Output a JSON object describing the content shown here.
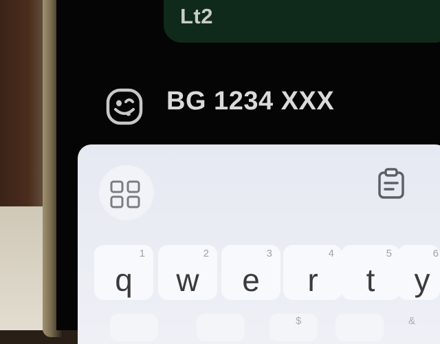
{
  "chat": {
    "last_sent_message_fragment": "Lt2"
  },
  "input": {
    "value": "BG 1234 XXX"
  },
  "icons": {
    "emoji": "emoji-icon",
    "keyboard_grid": "grid-icon",
    "clipboard": "clipboard-icon"
  },
  "keyboard": {
    "row1": [
      {
        "letter": "q",
        "number": "1"
      },
      {
        "letter": "w",
        "number": "2"
      },
      {
        "letter": "e",
        "number": "3"
      },
      {
        "letter": "r",
        "number": "4"
      },
      {
        "letter": "t",
        "number": "5"
      },
      {
        "letter": "y",
        "number": "6"
      }
    ],
    "row2_hints": [
      "$",
      "&"
    ]
  }
}
